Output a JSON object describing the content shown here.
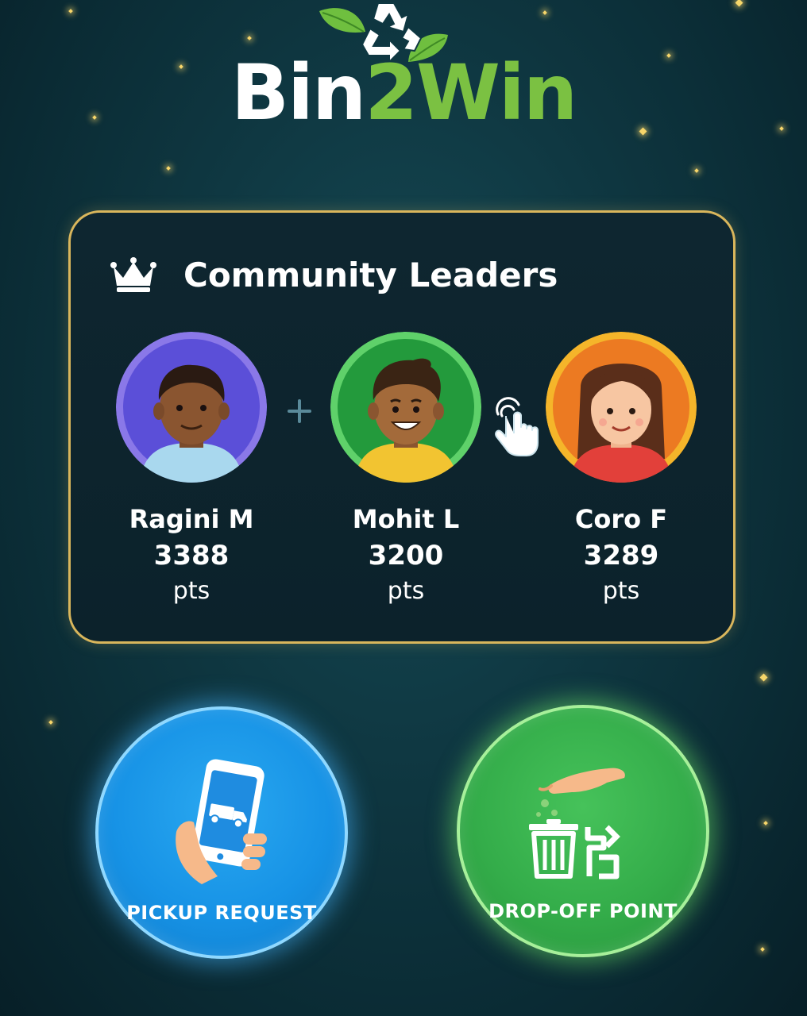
{
  "app": {
    "name_part1": "Bin",
    "name_part2": "2Win"
  },
  "leaders_card": {
    "title": "Community Leaders",
    "leaders": [
      {
        "name": "Ragini M",
        "points": "3388",
        "unit": "pts"
      },
      {
        "name": "Mohit L",
        "points": "3200",
        "unit": "pts"
      },
      {
        "name": "Coro F",
        "points": "3289",
        "unit": "pts"
      }
    ]
  },
  "actions": {
    "pickup_label": "PICKUP REQUEST",
    "dropoff_label": "DROP-OFF POINT"
  },
  "icons": {
    "logo": "recycle-leaves-icon",
    "header": "crown-icon",
    "between_1_2": "plus-icon",
    "between_2_3": "tap-hand-icon",
    "pickup": "phone-truck-hand-icon",
    "dropoff": "hand-trash-bin-icon"
  },
  "colors": {
    "brand_green": "#7bc142",
    "card_border_gold": "#d9b65c",
    "pickup_blue": "#1793e6",
    "dropoff_green": "#34ad4a",
    "avatar_ring_1": "#8a78e8",
    "avatar_ring_2": "#5fd16a",
    "avatar_ring_3": "#f5b52a"
  }
}
